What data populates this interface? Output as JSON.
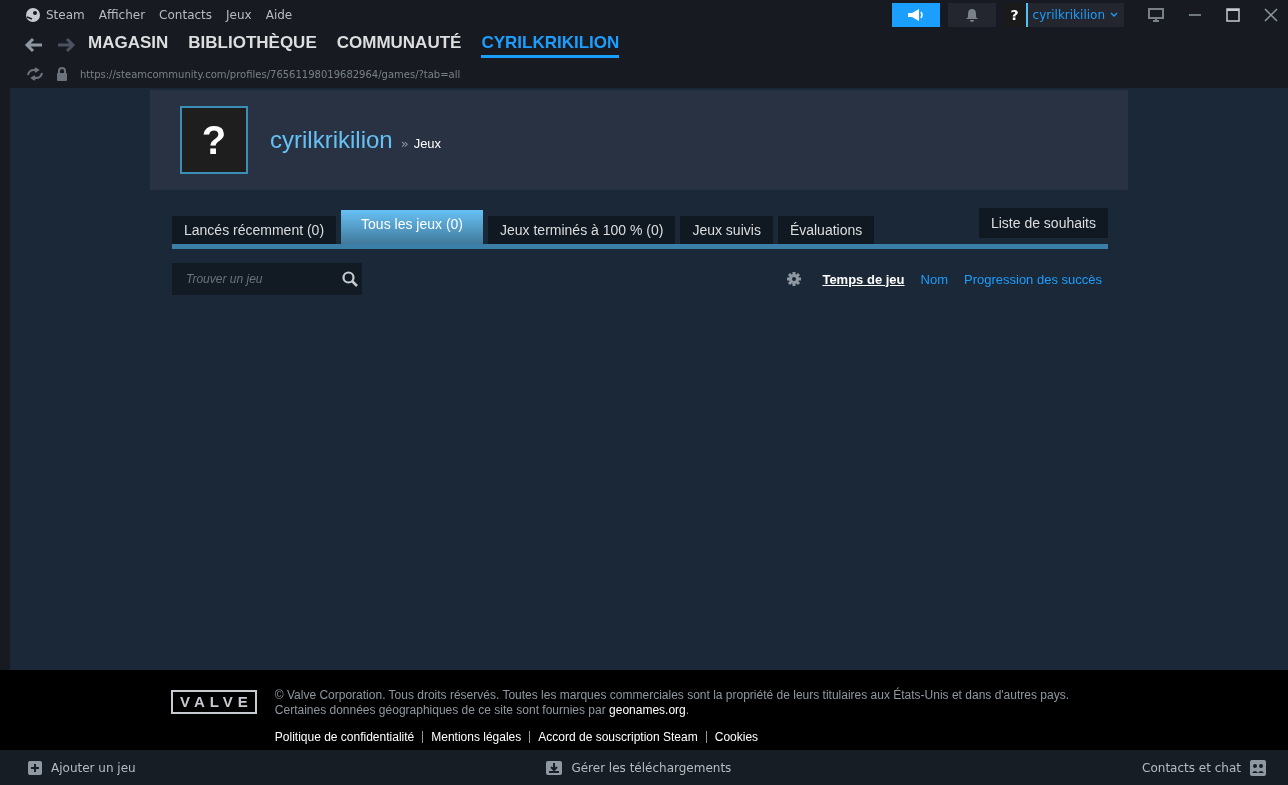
{
  "menu": [
    "Steam",
    "Afficher",
    "Contacts",
    "Jeux",
    "Aide"
  ],
  "account": {
    "name": "cyrilkrikilion",
    "avatar": "?"
  },
  "nav": [
    {
      "label": "MAGASIN",
      "selected": false
    },
    {
      "label": "BIBLIOTHÈQUE",
      "selected": false
    },
    {
      "label": "COMMUNAUTÉ",
      "selected": false
    },
    {
      "label": "CYRILKRIKILION",
      "selected": true
    }
  ],
  "url": "https://steamcommunity.com/profiles/76561198019682964/games/?tab=all",
  "profile": {
    "avatar": "?",
    "name": "cyrilkrikilion",
    "separator": "»",
    "section": "Jeux"
  },
  "tabs": [
    {
      "label": "Lancés récemment (0)",
      "selected": false
    },
    {
      "label": "Tous les jeux (0)",
      "selected": true
    },
    {
      "label": "Jeux terminés à 100 % (0)",
      "selected": false
    },
    {
      "label": "Jeux suivis",
      "selected": false
    },
    {
      "label": "Évaluations",
      "selected": false
    }
  ],
  "wishlist": "Liste de souhaits",
  "search": {
    "placeholder": "Trouver un jeu"
  },
  "sort": [
    {
      "label": "Temps de jeu",
      "selected": true
    },
    {
      "label": "Nom",
      "selected": false
    },
    {
      "label": "Progression des succès",
      "selected": false
    }
  ],
  "footer": {
    "logo": "VALVE",
    "legal": "© Valve Corporation. Tous droits réservés. Toutes les marques commerciales sont la propriété de leurs titulaires aux États-Unis et dans d'autres pays.",
    "geo": "Certaines données géographiques de ce site sont fournies par",
    "geo_link": "geonames.org",
    "geo_end": ".",
    "links": [
      "Politique de confidentialité",
      "Mentions légales",
      "Accord de souscription Steam",
      "Cookies"
    ]
  },
  "bottom": {
    "add": "Ajouter un jeu",
    "downloads": "Gérer les téléchargements",
    "friends": "Contacts et chat"
  }
}
